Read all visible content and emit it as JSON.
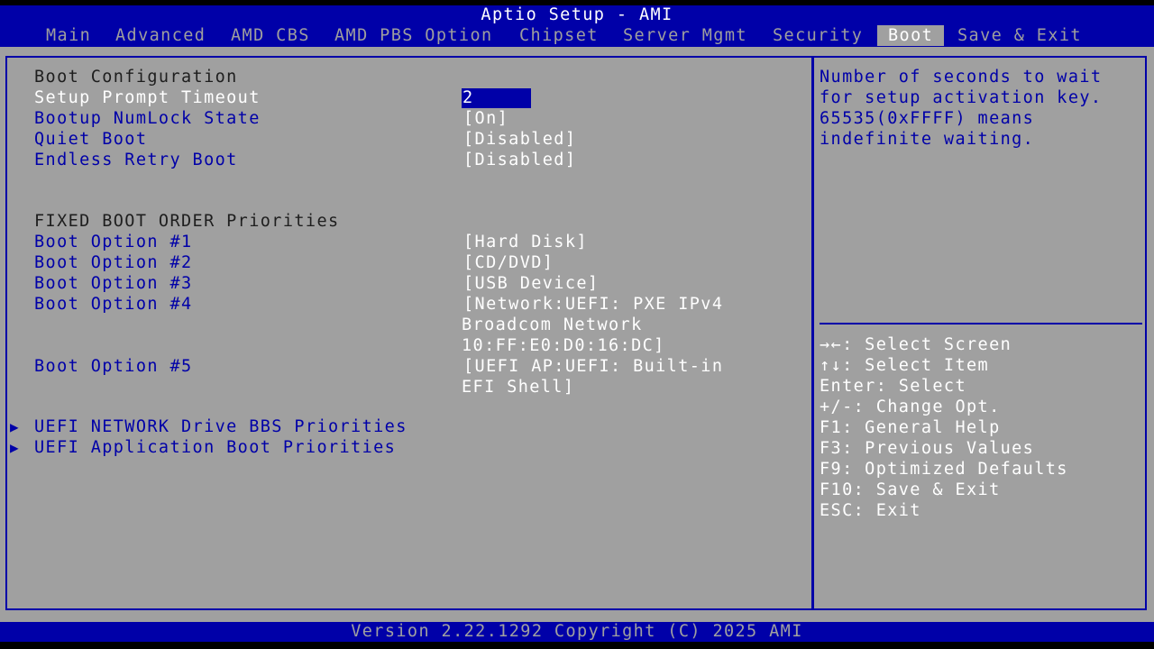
{
  "window": {
    "title": "Aptio Setup - AMI"
  },
  "menu_tabs": [
    {
      "label": "Main"
    },
    {
      "label": "Advanced"
    },
    {
      "label": "AMD CBS"
    },
    {
      "label": "AMD PBS Option"
    },
    {
      "label": "Chipset"
    },
    {
      "label": "Server Mgmt"
    },
    {
      "label": "Security"
    },
    {
      "label": "Boot",
      "active": true
    },
    {
      "label": "Save & Exit"
    }
  ],
  "boot": {
    "section_title": "Boot Configuration",
    "settings": [
      {
        "label": "Setup Prompt Timeout",
        "value": "2",
        "selected": true
      },
      {
        "label": "Bootup NumLock State",
        "value": "[On]"
      },
      {
        "label": "Quiet Boot",
        "value": "[Disabled]"
      },
      {
        "label": "Endless Retry Boot",
        "value": "[Disabled]"
      }
    ],
    "priorities_title": "FIXED BOOT ORDER Priorities",
    "boot_options": [
      {
        "label": "Boot Option #1",
        "value_lines": [
          "[Hard Disk]"
        ]
      },
      {
        "label": "Boot Option #2",
        "value_lines": [
          "[CD/DVD]"
        ]
      },
      {
        "label": "Boot Option #3",
        "value_lines": [
          "[USB Device]"
        ]
      },
      {
        "label": "Boot Option #4",
        "value_lines": [
          "[Network:UEFI: PXE IPv4",
          "Broadcom Network",
          "10:FF:E0:D0:16:DC]"
        ]
      },
      {
        "label": "Boot Option #5",
        "value_lines": [
          "[UEFI AP:UEFI: Built-in",
          "EFI Shell]"
        ]
      }
    ],
    "submenus": [
      {
        "label": "UEFI NETWORK Drive BBS Priorities"
      },
      {
        "label": "UEFI Application Boot Priorities"
      }
    ]
  },
  "help": {
    "lines": [
      "Number of seconds to wait",
      "for setup activation key.",
      "65535(0xFFFF) means",
      "indefinite waiting."
    ]
  },
  "keys": [
    "→←: Select Screen",
    "↑↓: Select Item",
    "Enter: Select",
    "+/-: Change Opt.",
    "F1: General Help",
    "F3: Previous Values",
    "F9: Optimized Defaults",
    "F10: Save & Exit",
    "ESC: Exit"
  ],
  "footer": {
    "text": "Version 2.22.1292 Copyright (C) 2025 AMI"
  },
  "colors": {
    "header_bg": "#0000a8",
    "body_bg": "#a0a0a0",
    "selectable_text": "#0000a8",
    "highlight_text": "#ffffff",
    "inactive_tab_text": "#9e9e9e"
  }
}
